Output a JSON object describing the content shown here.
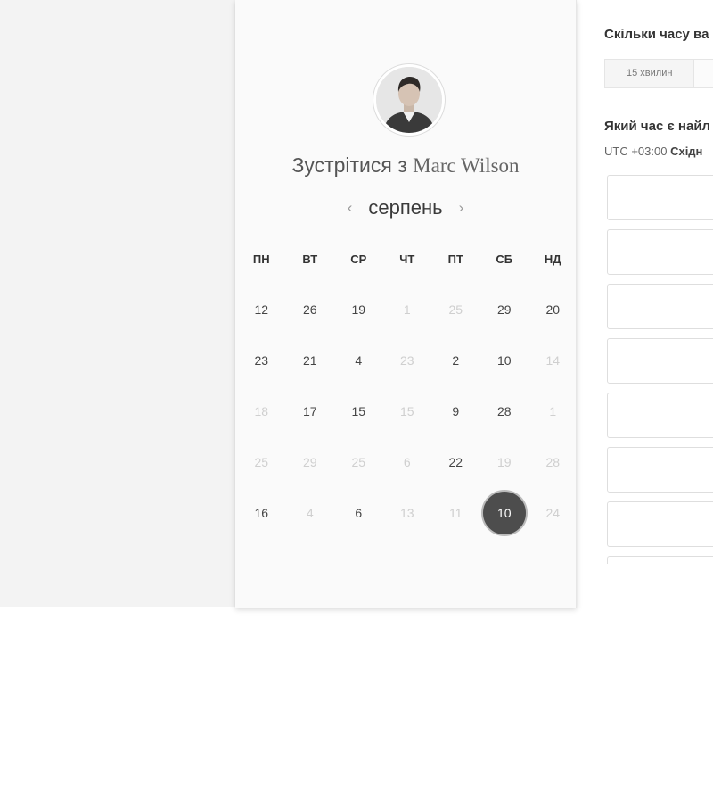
{
  "scheduler": {
    "title_prefix": "Зустрітися з",
    "host_name": "Marc Wilson",
    "month": "серпень",
    "prev_icon": "‹",
    "next_icon": "›",
    "weekdays": [
      "ПН",
      "ВТ",
      "СР",
      "ЧТ",
      "ПТ",
      "СБ",
      "НД"
    ],
    "weeks": [
      [
        {
          "d": "12",
          "m": false
        },
        {
          "d": "26",
          "m": false
        },
        {
          "d": "19",
          "m": false
        },
        {
          "d": "1",
          "m": true
        },
        {
          "d": "25",
          "m": true
        },
        {
          "d": "29",
          "m": false
        },
        {
          "d": "20",
          "m": false
        }
      ],
      [
        {
          "d": "23",
          "m": false
        },
        {
          "d": "21",
          "m": false
        },
        {
          "d": "4",
          "m": false
        },
        {
          "d": "23",
          "m": true
        },
        {
          "d": "2",
          "m": false
        },
        {
          "d": "10",
          "m": false
        },
        {
          "d": "14",
          "m": true
        }
      ],
      [
        {
          "d": "18",
          "m": true
        },
        {
          "d": "17",
          "m": false
        },
        {
          "d": "15",
          "m": false
        },
        {
          "d": "15",
          "m": true
        },
        {
          "d": "9",
          "m": false
        },
        {
          "d": "28",
          "m": false
        },
        {
          "d": "1",
          "m": true
        }
      ],
      [
        {
          "d": "25",
          "m": true
        },
        {
          "d": "29",
          "m": true
        },
        {
          "d": "25",
          "m": true
        },
        {
          "d": "6",
          "m": true
        },
        {
          "d": "22",
          "m": false
        },
        {
          "d": "19",
          "m": true
        },
        {
          "d": "28",
          "m": true
        }
      ],
      [
        {
          "d": "16",
          "m": false
        },
        {
          "d": "4",
          "m": true
        },
        {
          "d": "6",
          "m": false
        },
        {
          "d": "13",
          "m": true
        },
        {
          "d": "11",
          "m": true
        },
        {
          "d": "10",
          "m": false,
          "selected": true
        },
        {
          "d": "24",
          "m": true
        }
      ]
    ]
  },
  "booking": {
    "duration_question": "Скільки часу ва",
    "duration_options": [
      "15 хвилин"
    ],
    "time_question": "Який час є найл",
    "timezone_offset": "UTC +03:00",
    "timezone_name": "Східн",
    "slot_count": 8
  },
  "colors": {
    "selected_day": "#4d4d4d",
    "muted_day": "#cfcfcf"
  }
}
